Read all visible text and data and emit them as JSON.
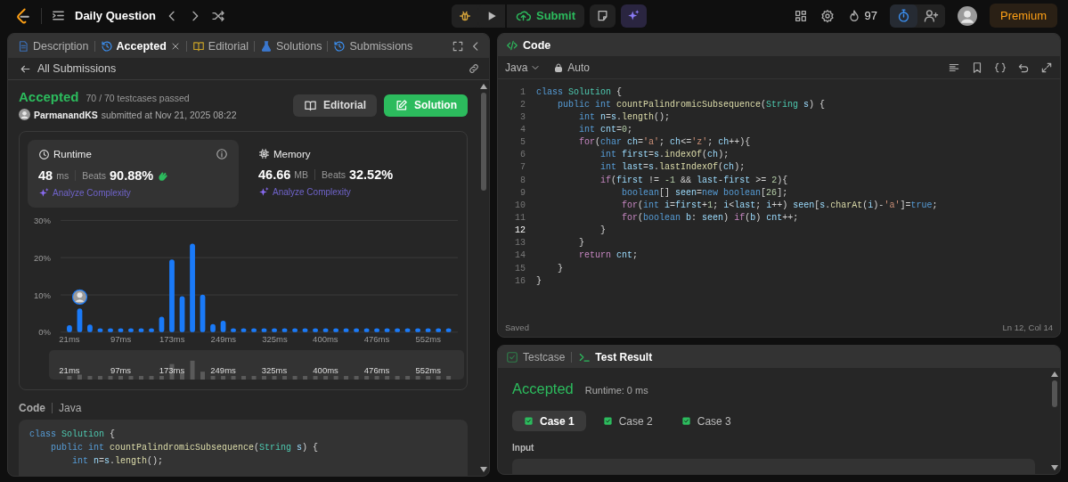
{
  "top_bar": {
    "title": "Daily Question",
    "submit": "Submit",
    "streak": "97",
    "premium": "Premium"
  },
  "left_panel": {
    "tabs": [
      {
        "label": "Description",
        "kind": "doc",
        "selected": false,
        "closable": false
      },
      {
        "label": "Accepted",
        "kind": "history",
        "selected": true,
        "closable": true
      },
      {
        "label": "Editorial",
        "kind": "book",
        "selected": false,
        "closable": false
      },
      {
        "label": "Solutions",
        "kind": "flask",
        "selected": false,
        "closable": false
      },
      {
        "label": "Submissions",
        "kind": "history",
        "selected": false,
        "closable": false
      }
    ],
    "back_link": "All Submissions",
    "submission": {
      "status": "Accepted",
      "cases": "70 / 70 testcases passed",
      "user": "ParmanandKS",
      "submitted": "submitted at Nov 21, 2025 08:22",
      "buttons": [
        {
          "label": "Editorial",
          "kind": "secondary"
        },
        {
          "label": "Solution",
          "kind": "primary"
        }
      ]
    },
    "stats": [
      {
        "kind": "runtime",
        "title": "Runtime",
        "value": "48",
        "unit": "ms",
        "beats_label": "Beats",
        "beats": "90.88%",
        "link": "Analyze Complexity",
        "selected": true
      },
      {
        "kind": "memory",
        "title": "Memory",
        "value": "46.66",
        "unit": "MB",
        "beats_label": "Beats",
        "beats": "32.52%",
        "link": "Analyze Complexity",
        "selected": false
      }
    ],
    "chart_data": {
      "type": "bar",
      "x": [
        21,
        36.2,
        51.3,
        66.5,
        81.7,
        96.9,
        112,
        127.2,
        142.4,
        157.5,
        172.7,
        187.9,
        203.1,
        218.2,
        233.4,
        248.6,
        263.7,
        278.9,
        294.1,
        309.2,
        324.4,
        339.6,
        354.8,
        369.9,
        385.1,
        400.3,
        415.5,
        430.6,
        445.8,
        461,
        476.1,
        491.3,
        506.5,
        521.6,
        536.8,
        552,
        567.2,
        582.3
      ],
      "values": [
        1.6,
        6.1,
        1.8,
        0.8,
        0.8,
        0.8,
        0.8,
        0.8,
        0.8,
        3.9,
        19.3,
        9.4,
        23.5,
        9.8,
        1.9,
        2.8,
        0.8,
        0.8,
        0.8,
        0.8,
        0.8,
        0.8,
        0.8,
        0.8,
        0.8,
        0.8,
        0.8,
        0.8,
        0.8,
        0.8,
        0.8,
        0.8,
        0.8,
        0.8,
        0.8,
        0.8,
        0.8,
        0.8
      ],
      "xlim": [
        8,
        596
      ],
      "ylim": [
        0,
        30
      ],
      "xticks": [
        {
          "value": 21,
          "label": "21ms"
        },
        {
          "value": 97,
          "label": "97ms"
        },
        {
          "value": 173,
          "label": "173ms"
        },
        {
          "value": 249,
          "label": "249ms"
        },
        {
          "value": 325,
          "label": "325ms"
        },
        {
          "value": 400,
          "label": "400ms"
        },
        {
          "value": 476,
          "label": "476ms"
        },
        {
          "value": 552,
          "label": "552ms"
        }
      ],
      "yticks": [
        {
          "value": 0,
          "label": "0%"
        },
        {
          "value": 10,
          "label": "10%"
        },
        {
          "value": 20,
          "label": "20%"
        },
        {
          "value": 30,
          "label": "30%"
        }
      ]
    },
    "overview": {
      "tick_labels": [
        "21ms",
        "97ms",
        "173ms",
        "249ms",
        "325ms",
        "400ms",
        "476ms",
        "552ms"
      ]
    },
    "code": {
      "label": "Code",
      "language": "Java",
      "lines": [
        {
          "tokens": [
            {
              "kind": "keyword",
              "text": "class "
            },
            {
              "kind": "type",
              "text": "Solution"
            },
            {
              "kind": "plain",
              "text": " {"
            }
          ]
        },
        {
          "tokens": [
            {
              "kind": "keyword",
              "text": "    public "
            },
            {
              "kind": "keyword",
              "text": "int "
            },
            {
              "kind": "function",
              "text": "countPalindromicSubsequence"
            },
            {
              "kind": "plain",
              "text": "("
            },
            {
              "kind": "type",
              "text": "String "
            },
            {
              "kind": "variable",
              "text": "s"
            },
            {
              "kind": "plain",
              "text": ") {"
            }
          ]
        },
        {
          "tokens": [
            {
              "kind": "keyword",
              "text": "        int "
            },
            {
              "kind": "variable",
              "text": "n"
            },
            {
              "kind": "plain",
              "text": "="
            },
            {
              "kind": "variable",
              "text": "s"
            },
            {
              "kind": "plain",
              "text": "."
            },
            {
              "kind": "function",
              "text": "length"
            },
            {
              "kind": "plain",
              "text": "();"
            }
          ]
        }
      ]
    }
  },
  "editor": {
    "title": "Code",
    "language": "Java",
    "mode": "Auto",
    "lines": [
      {
        "number": "1",
        "current": false,
        "tokens": [
          {
            "kind": "keyword",
            "text": "class "
          },
          {
            "kind": "type",
            "text": "Solution"
          },
          {
            "kind": "plain",
            "text": " {"
          }
        ]
      },
      {
        "number": "2",
        "current": false,
        "tokens": [
          {
            "kind": "keyword",
            "text": "    public "
          },
          {
            "kind": "keyword",
            "text": "int "
          },
          {
            "kind": "function",
            "text": "countPalindromicSubsequence"
          },
          {
            "kind": "plain",
            "text": "("
          },
          {
            "kind": "type",
            "text": "String "
          },
          {
            "kind": "variable",
            "text": "s"
          },
          {
            "kind": "plain",
            "text": ") {"
          }
        ]
      },
      {
        "number": "3",
        "current": false,
        "tokens": [
          {
            "kind": "keyword",
            "text": "        int "
          },
          {
            "kind": "variable",
            "text": "n"
          },
          {
            "kind": "plain",
            "text": "="
          },
          {
            "kind": "variable",
            "text": "s"
          },
          {
            "kind": "plain",
            "text": "."
          },
          {
            "kind": "function",
            "text": "length"
          },
          {
            "kind": "plain",
            "text": "();"
          }
        ]
      },
      {
        "number": "4",
        "current": false,
        "tokens": [
          {
            "kind": "keyword",
            "text": "        int "
          },
          {
            "kind": "variable",
            "text": "cnt"
          },
          {
            "kind": "plain",
            "text": "="
          },
          {
            "kind": "number",
            "text": "0"
          },
          {
            "kind": "plain",
            "text": ";"
          }
        ]
      },
      {
        "number": "5",
        "current": false,
        "tokens": [
          {
            "kind": "control",
            "text": "        for"
          },
          {
            "kind": "plain",
            "text": "("
          },
          {
            "kind": "keyword",
            "text": "char "
          },
          {
            "kind": "variable",
            "text": "ch"
          },
          {
            "kind": "plain",
            "text": "="
          },
          {
            "kind": "string",
            "text": "'a'"
          },
          {
            "kind": "plain",
            "text": "; "
          },
          {
            "kind": "variable",
            "text": "ch"
          },
          {
            "kind": "plain",
            "text": "<="
          },
          {
            "kind": "string",
            "text": "'z'"
          },
          {
            "kind": "plain",
            "text": "; "
          },
          {
            "kind": "variable",
            "text": "ch"
          },
          {
            "kind": "plain",
            "text": "++){"
          }
        ]
      },
      {
        "number": "6",
        "current": false,
        "tokens": [
          {
            "kind": "keyword",
            "text": "            int "
          },
          {
            "kind": "variable",
            "text": "first"
          },
          {
            "kind": "plain",
            "text": "="
          },
          {
            "kind": "variable",
            "text": "s"
          },
          {
            "kind": "plain",
            "text": "."
          },
          {
            "kind": "function",
            "text": "indexOf"
          },
          {
            "kind": "plain",
            "text": "("
          },
          {
            "kind": "variable",
            "text": "ch"
          },
          {
            "kind": "plain",
            "text": ");"
          }
        ]
      },
      {
        "number": "7",
        "current": false,
        "tokens": [
          {
            "kind": "keyword",
            "text": "            int "
          },
          {
            "kind": "variable",
            "text": "last"
          },
          {
            "kind": "plain",
            "text": "="
          },
          {
            "kind": "variable",
            "text": "s"
          },
          {
            "kind": "plain",
            "text": "."
          },
          {
            "kind": "function",
            "text": "lastIndexOf"
          },
          {
            "kind": "plain",
            "text": "("
          },
          {
            "kind": "variable",
            "text": "ch"
          },
          {
            "kind": "plain",
            "text": ");"
          }
        ]
      },
      {
        "number": "8",
        "current": false,
        "tokens": [
          {
            "kind": "control",
            "text": "            if"
          },
          {
            "kind": "plain",
            "text": "("
          },
          {
            "kind": "variable",
            "text": "first"
          },
          {
            "kind": "plain",
            "text": " != "
          },
          {
            "kind": "number",
            "text": "-1"
          },
          {
            "kind": "plain",
            "text": " && "
          },
          {
            "kind": "variable",
            "text": "last"
          },
          {
            "kind": "plain",
            "text": "-"
          },
          {
            "kind": "variable",
            "text": "first"
          },
          {
            "kind": "plain",
            "text": " >= "
          },
          {
            "kind": "number",
            "text": "2"
          },
          {
            "kind": "plain",
            "text": "){"
          }
        ]
      },
      {
        "number": "9",
        "current": false,
        "tokens": [
          {
            "kind": "keyword",
            "text": "                boolean"
          },
          {
            "kind": "plain",
            "text": "[] "
          },
          {
            "kind": "variable",
            "text": "seen"
          },
          {
            "kind": "plain",
            "text": "="
          },
          {
            "kind": "keyword",
            "text": "new boolean"
          },
          {
            "kind": "plain",
            "text": "["
          },
          {
            "kind": "number",
            "text": "26"
          },
          {
            "kind": "plain",
            "text": "];"
          }
        ]
      },
      {
        "number": "10",
        "current": false,
        "tokens": [
          {
            "kind": "control",
            "text": "                for"
          },
          {
            "kind": "plain",
            "text": "("
          },
          {
            "kind": "keyword",
            "text": "int "
          },
          {
            "kind": "variable",
            "text": "i"
          },
          {
            "kind": "plain",
            "text": "="
          },
          {
            "kind": "variable",
            "text": "first"
          },
          {
            "kind": "plain",
            "text": "+"
          },
          {
            "kind": "number",
            "text": "1"
          },
          {
            "kind": "plain",
            "text": "; "
          },
          {
            "kind": "variable",
            "text": "i"
          },
          {
            "kind": "plain",
            "text": "<"
          },
          {
            "kind": "variable",
            "text": "last"
          },
          {
            "kind": "plain",
            "text": "; "
          },
          {
            "kind": "variable",
            "text": "i"
          },
          {
            "kind": "plain",
            "text": "++) "
          },
          {
            "kind": "variable",
            "text": "seen"
          },
          {
            "kind": "plain",
            "text": "["
          },
          {
            "kind": "variable",
            "text": "s"
          },
          {
            "kind": "plain",
            "text": "."
          },
          {
            "kind": "function",
            "text": "charAt"
          },
          {
            "kind": "plain",
            "text": "("
          },
          {
            "kind": "variable",
            "text": "i"
          },
          {
            "kind": "plain",
            "text": ")-"
          },
          {
            "kind": "string",
            "text": "'a'"
          },
          {
            "kind": "plain",
            "text": "]="
          },
          {
            "kind": "keyword",
            "text": "true"
          },
          {
            "kind": "plain",
            "text": ";"
          }
        ]
      },
      {
        "number": "11",
        "current": false,
        "tokens": [
          {
            "kind": "control",
            "text": "                for"
          },
          {
            "kind": "plain",
            "text": "("
          },
          {
            "kind": "keyword",
            "text": "boolean "
          },
          {
            "kind": "variable",
            "text": "b"
          },
          {
            "kind": "plain",
            "text": ": "
          },
          {
            "kind": "variable",
            "text": "seen"
          },
          {
            "kind": "plain",
            "text": ") "
          },
          {
            "kind": "control",
            "text": "if"
          },
          {
            "kind": "plain",
            "text": "("
          },
          {
            "kind": "variable",
            "text": "b"
          },
          {
            "kind": "plain",
            "text": ") "
          },
          {
            "kind": "variable",
            "text": "cnt"
          },
          {
            "kind": "plain",
            "text": "++;"
          }
        ]
      },
      {
        "number": "12",
        "current": true,
        "tokens": [
          {
            "kind": "plain",
            "text": "            }"
          }
        ]
      },
      {
        "number": "13",
        "current": false,
        "tokens": [
          {
            "kind": "plain",
            "text": "        }"
          }
        ]
      },
      {
        "number": "14",
        "current": false,
        "tokens": [
          {
            "kind": "control",
            "text": "        return "
          },
          {
            "kind": "variable",
            "text": "cnt"
          },
          {
            "kind": "plain",
            "text": ";"
          }
        ]
      },
      {
        "number": "15",
        "current": false,
        "tokens": [
          {
            "kind": "plain",
            "text": "    }"
          }
        ]
      },
      {
        "number": "16",
        "current": false,
        "tokens": [
          {
            "kind": "plain",
            "text": "}"
          }
        ]
      }
    ],
    "saved": "Saved",
    "cursor": "Ln 12, Col 14"
  },
  "result": {
    "tabs": [
      {
        "label": "Testcase",
        "kind": "check",
        "selected": false
      },
      {
        "label": "Test Result",
        "kind": "terminal",
        "selected": true
      }
    ],
    "status": "Accepted",
    "runtime": "Runtime: 0 ms",
    "cases": [
      {
        "label": "Case 1",
        "selected": true,
        "passed": true
      },
      {
        "label": "Case 2",
        "selected": false,
        "passed": true
      },
      {
        "label": "Case 3",
        "selected": false,
        "passed": true
      }
    ],
    "input_label": "Input"
  }
}
